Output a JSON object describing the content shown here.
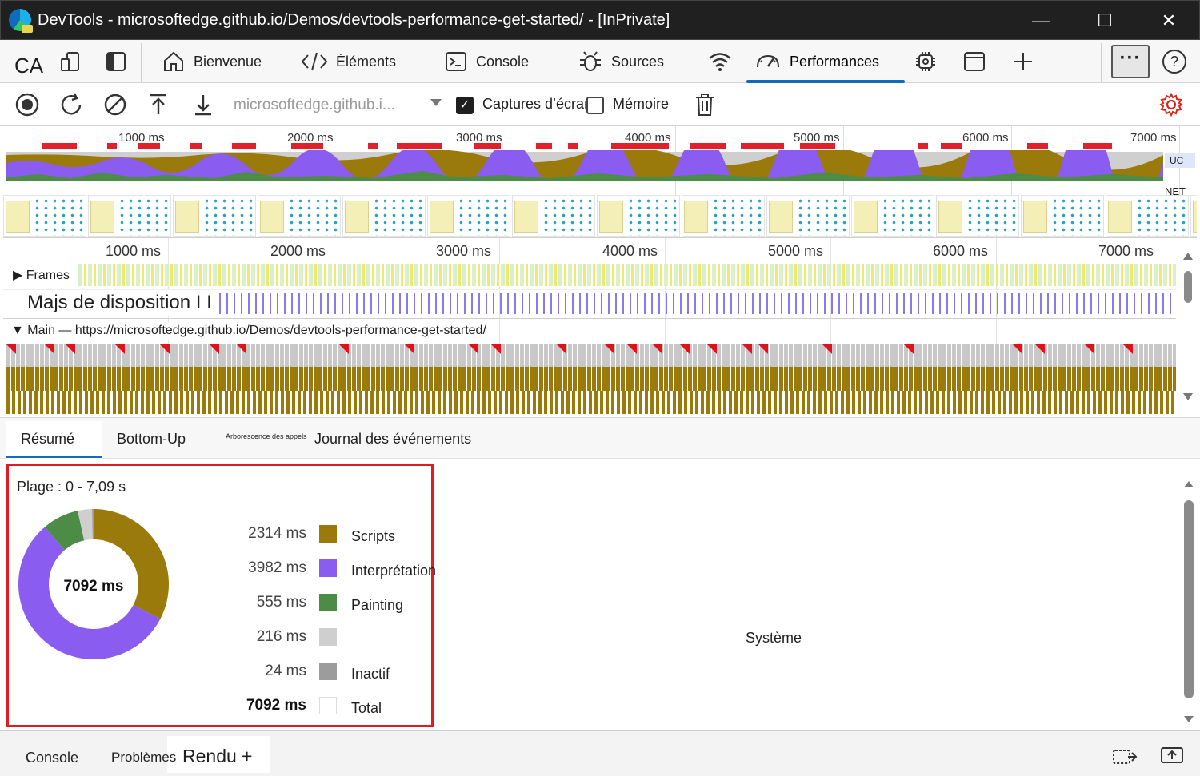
{
  "window": {
    "title": "DevTools - microsoftedge.github.io/Demos/devtools-performance-get-started/ - [InPrivate]",
    "minimize": "—",
    "maximize": "☐",
    "close": "✕"
  },
  "tabbar": {
    "device_label": "CA",
    "tabs": [
      {
        "label": "Bienvenue",
        "icon": "home-icon"
      },
      {
        "label": "Éléments",
        "icon": "code-icon"
      },
      {
        "label": "Console",
        "icon": "console-icon"
      },
      {
        "label": "Sources",
        "icon": "bug-icon"
      },
      {
        "label": "",
        "icon": "wifi-icon"
      },
      {
        "label": "Performances",
        "icon": "performance-icon",
        "active": true
      }
    ],
    "more_label": "···",
    "help_label": "?"
  },
  "toolbar": {
    "url_placeholder": "microsoftedge.github.i...",
    "screenshots_label": "Captures d’écran",
    "screenshots_checked": true,
    "memory_label": "Mémoire",
    "memory_checked": false
  },
  "overview": {
    "ticks": [
      "1000 ms",
      "2000 ms",
      "3000 ms",
      "4000 ms",
      "5000 ms",
      "6000 ms",
      "7000 ms"
    ],
    "cpu_label": "UC",
    "net_label": "NET"
  },
  "timeline": {
    "ticks": [
      "1000 ms",
      "2000 ms",
      "3000 ms",
      "4000 ms",
      "5000 ms",
      "6000 ms",
      "7000 ms"
    ],
    "frames_label": "Frames",
    "layout_label": "Majs de disposition I I",
    "main_label": "Main — https://microsoftedge.github.io/Demos/devtools-performance-get-started/"
  },
  "panel_tabs": {
    "summary": "Résumé",
    "bottom_up": "Bottom-Up",
    "call_tree": "Arborescence des appels",
    "event_log": "Journal des événements"
  },
  "summary": {
    "range": "Plage : 0 - 7,09 s",
    "total_center": "7092 ms",
    "rows": [
      {
        "value": "2314 ms",
        "name": "Scripts",
        "color": "#9a7a0b",
        "ms": 2314
      },
      {
        "value": "3982 ms",
        "name": "Interprétation",
        "color": "#8a5cf0",
        "ms": 3982
      },
      {
        "value": "555 ms",
        "name": "Painting",
        "color": "#4c8c46",
        "ms": 555
      },
      {
        "value": "216 ms",
        "name": "",
        "color": "#cfcfcf",
        "ms": 216
      },
      {
        "value": "24 ms",
        "name": "Inactif",
        "color": "#9c9c9c",
        "ms": 24
      },
      {
        "value": "7092 ms",
        "name": "Total",
        "color": "#ffffff"
      }
    ],
    "system_label": "Système"
  },
  "drawer": {
    "console": "Console",
    "problems": "Problèmes",
    "rendering": "Rendu",
    "add": "+"
  },
  "colors": {
    "accent": "#0f6cbd",
    "highlight_border": "#e21b23",
    "scripting": "#9a7a0b",
    "rendering": "#8a5cf0",
    "painting": "#4c8c46"
  }
}
